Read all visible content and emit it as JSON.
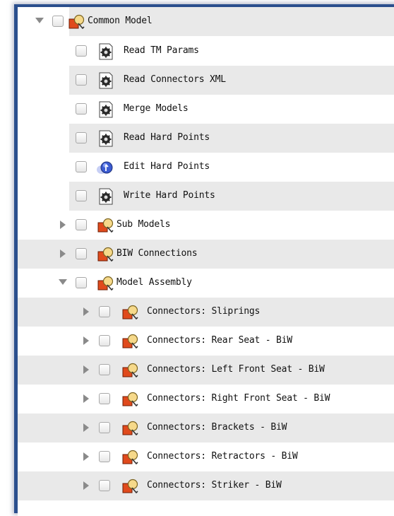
{
  "tree": {
    "rows": [
      {
        "label": "Common Model",
        "icon": "model-icon",
        "toggle": "expanded"
      },
      {
        "label": "Read TM Params",
        "icon": "gear-icon"
      },
      {
        "label": "Read Connectors XML",
        "icon": "gear-icon"
      },
      {
        "label": "Merge Models",
        "icon": "gear-icon"
      },
      {
        "label": "Read Hard Points",
        "icon": "gear-icon"
      },
      {
        "label": "Edit Hard Points",
        "icon": "interactive-icon"
      },
      {
        "label": "Write Hard Points",
        "icon": "gear-icon"
      },
      {
        "label": "Sub Models",
        "icon": "model-icon",
        "toggle": "collapsed"
      },
      {
        "label": "BIW Connections",
        "icon": "model-icon",
        "toggle": "collapsed"
      },
      {
        "label": "Model Assembly",
        "icon": "model-icon",
        "toggle": "expanded"
      },
      {
        "label": "Connectors: Sliprings",
        "icon": "model-icon",
        "toggle": "collapsed"
      },
      {
        "label": "Connectors: Rear Seat - BiW",
        "icon": "model-icon",
        "toggle": "collapsed"
      },
      {
        "label": "Connectors: Left Front Seat - BiW",
        "icon": "model-icon",
        "toggle": "collapsed"
      },
      {
        "label": "Connectors: Right Front Seat - BiW",
        "icon": "model-icon",
        "toggle": "collapsed"
      },
      {
        "label": "Connectors: Brackets - BiW",
        "icon": "model-icon",
        "toggle": "collapsed"
      },
      {
        "label": "Connectors: Retractors - BiW",
        "icon": "model-icon",
        "toggle": "collapsed"
      },
      {
        "label": "Connectors: Striker - BiW",
        "icon": "model-icon",
        "toggle": "collapsed"
      }
    ]
  }
}
